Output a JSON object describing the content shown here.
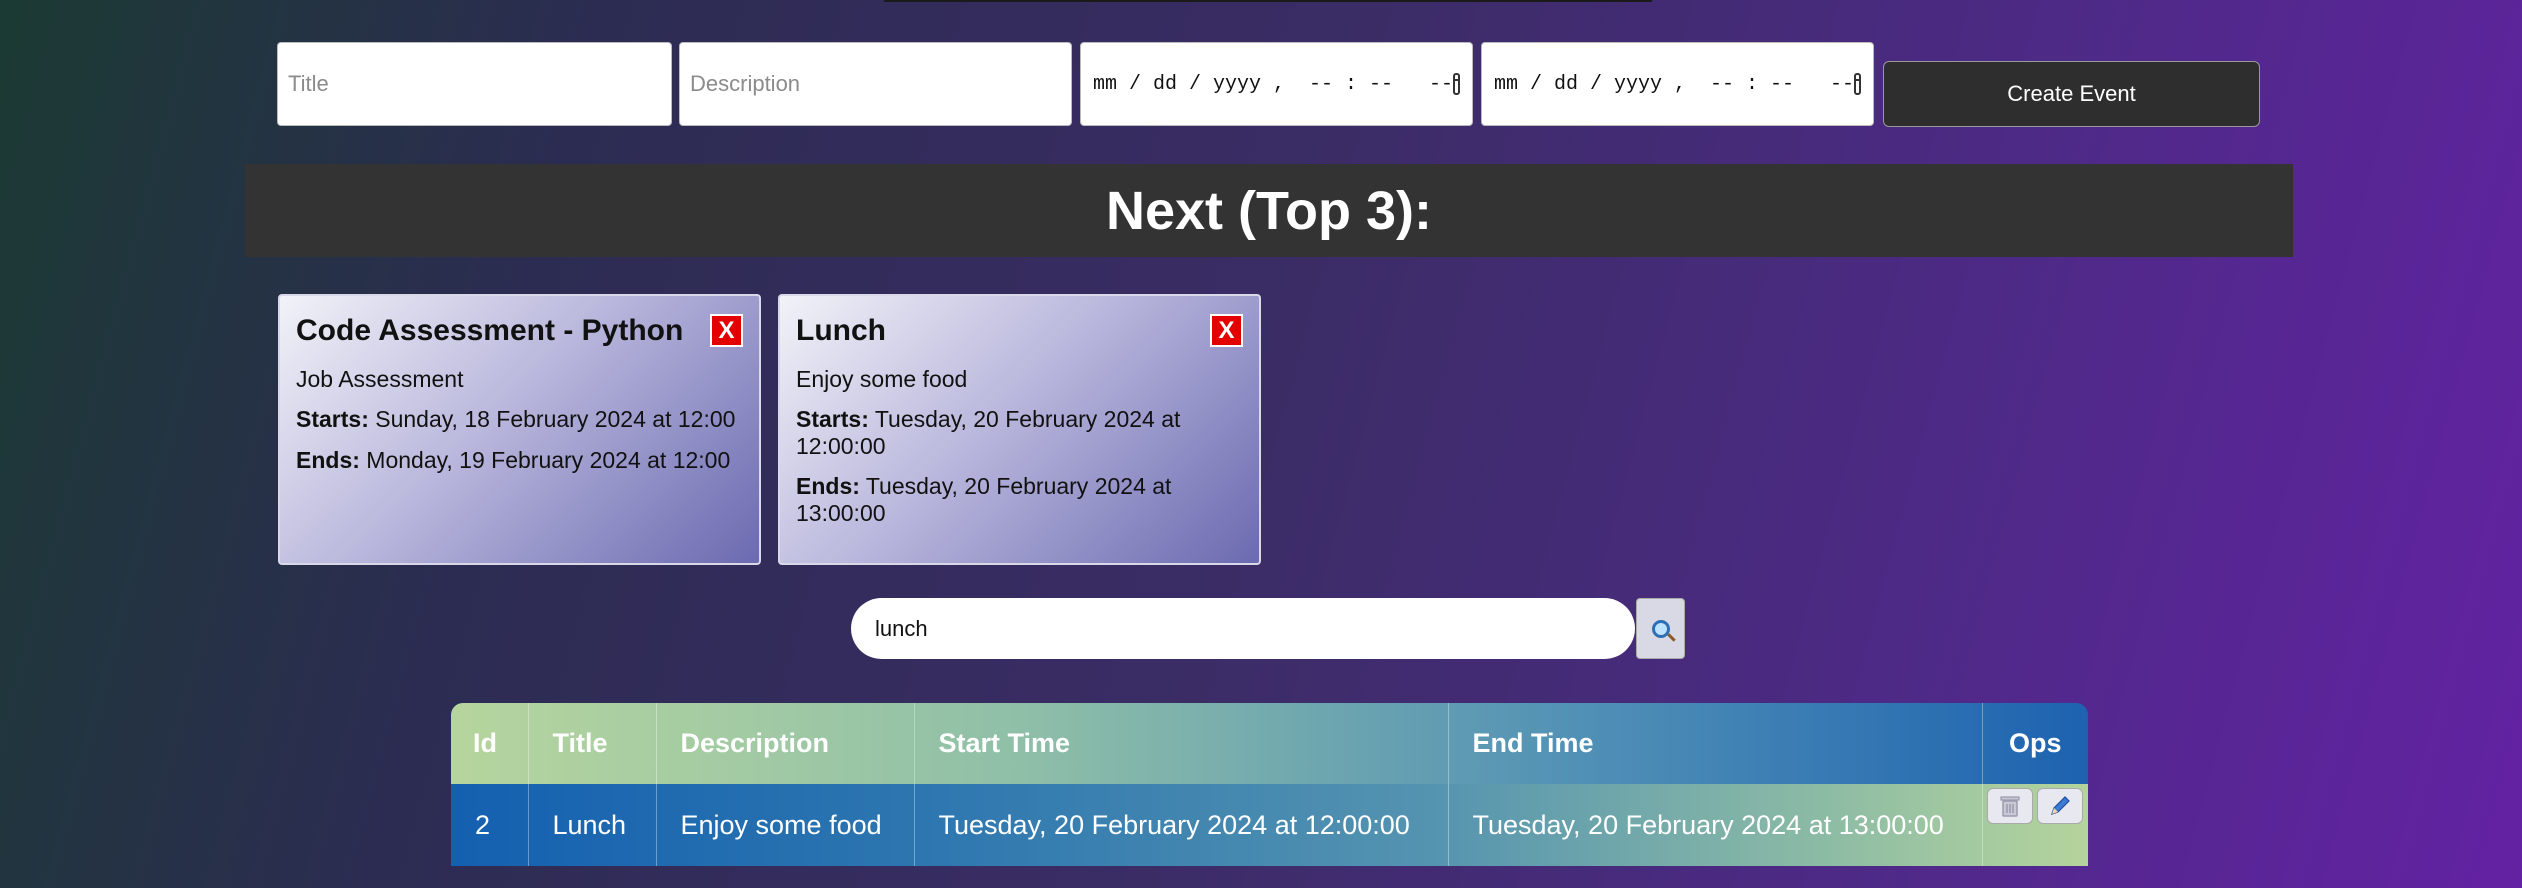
{
  "form": {
    "title_placeholder": "Title",
    "description_placeholder": "Description",
    "start_datetime_placeholder": "mm / dd / yyyy ,  -- : --   --",
    "end_datetime_placeholder": "mm / dd / yyyy ,  -- : --   --",
    "create_label": "Create Event"
  },
  "next": {
    "heading": "Next (Top 3):",
    "cards": [
      {
        "title": "Code Assessment - Python",
        "delete_label": "X",
        "description": "Job Assessment",
        "starts_label": "Starts:",
        "starts_value": " Sunday, 18 February 2024 at 12:00",
        "ends_label": "Ends:",
        "ends_value": " Monday, 19 February 2024 at 12:00"
      },
      {
        "title": "Lunch",
        "delete_label": "X",
        "description": "Enjoy some food",
        "starts_label": "Starts:",
        "starts_value": " Tuesday, 20 February 2024 at 12:00:00",
        "ends_label": "Ends:",
        "ends_value": " Tuesday, 20 February 2024 at 13:00:00"
      }
    ]
  },
  "search": {
    "value": "lunch",
    "button_icon": "magnifier-icon"
  },
  "table": {
    "headers": [
      "Id",
      "Title",
      "Description",
      "Start Time",
      "End Time",
      "Ops"
    ],
    "rows": [
      {
        "id": "2",
        "title": "Lunch",
        "description": "Enjoy some food",
        "start": "Tuesday, 20 February 2024 at 12:00:00",
        "end": "Tuesday, 20 February 2024 at 13:00:00",
        "ops": [
          "trash-icon",
          "pencil-icon"
        ]
      }
    ]
  },
  "colors": {
    "delete_red": "#e40000",
    "banner_bg": "#333333",
    "table_blue": "#1d62b0",
    "table_green": "#b6d59e"
  }
}
